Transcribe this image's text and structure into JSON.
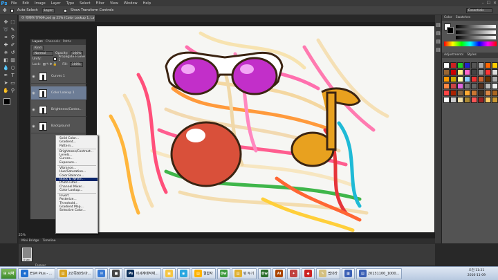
{
  "app": {
    "logo": "Ps"
  },
  "menu": [
    "File",
    "Edit",
    "Image",
    "Layer",
    "Type",
    "Select",
    "Filter",
    "View",
    "Window",
    "Help"
  ],
  "window_controls": [
    "–",
    "☐",
    "✕"
  ],
  "options": {
    "auto_select": "Auto-Select:",
    "layer_value": "Layer",
    "show_transform": "Show Transform Controls",
    "workspace": "Essentials"
  },
  "document": {
    "tab_title": "이 목배하기7909.psd @ 25% (Color Lookup 1, Layer Mask/8)"
  },
  "status": {
    "zoom": "25%"
  },
  "layers": {
    "tabs": [
      "Layers",
      "Channels",
      "Paths"
    ],
    "filter_kind": "Kind",
    "blend_mode": "Normal",
    "opacity_label": "Opacity:",
    "opacity_value": "100%",
    "unify_label": "Unify:",
    "propagate_label": "Propagate Frame 1",
    "lock_label": "Lock:",
    "fill_label": "Fill:",
    "fill_value": "100%",
    "items": [
      {
        "name": "Curves 1"
      },
      {
        "name": "Color Lookup 1"
      },
      {
        "name": "Brightness/Contra..."
      },
      {
        "name": "Background"
      }
    ]
  },
  "context_menu": {
    "groups": [
      [
        "Solid Color...",
        "Gradient...",
        "Pattern..."
      ],
      [
        "Brightness/Contrast...",
        "Levels...",
        "Curves...",
        "Exposure..."
      ],
      [
        "Vibrance...",
        "Hue/Saturation...",
        "Color Balance...",
        "Black & White...",
        "Photo Filter...",
        "Channel Mixer...",
        "Color Lookup..."
      ],
      [
        "Invert",
        "Posterize...",
        "Threshold...",
        "Gradient Map...",
        "Selective Color..."
      ]
    ],
    "highlighted": "Black & White..."
  },
  "right_panel": {
    "color_tabs": [
      "Color",
      "Swatches"
    ],
    "style_tabs": [
      "Adjustments",
      "Styles"
    ]
  },
  "timeline": {
    "tabs": [
      "Mini Bridge",
      "Timeline"
    ],
    "frame_delay": "0 sec.",
    "loop": "Forever"
  },
  "taskbar": {
    "start": "시작",
    "items": [
      {
        "label": "ESM Plus - ...",
        "icon_color": "#1f6fd1",
        "icon": "e"
      },
      {
        "label": "2안쪽정리(아...",
        "icon_color": "#d9a420",
        "icon": "▤"
      },
      {
        "label": "",
        "icon_color": "#3a7bd5",
        "icon": "✉"
      },
      {
        "label": "",
        "icon_color": "#444444",
        "icon": "■"
      },
      {
        "label": "이세계에적재...",
        "icon_color": "#0b2f5a",
        "icon": "Ps"
      },
      {
        "label": "",
        "icon_color": "#f5c542",
        "icon": "▣"
      },
      {
        "label": "",
        "icon_color": "#2aa7e0",
        "icon": "◉"
      },
      {
        "label": "결합자",
        "icon_color": "#ffb300",
        "icon": "▤"
      },
      {
        "label": "",
        "icon_color": "#3c9a3c",
        "icon": "Dw"
      },
      {
        "label": "뭐 두기",
        "icon_color": "#e0b030",
        "icon": "▤"
      },
      {
        "label": "",
        "icon_color": "#2b6e2b",
        "icon": "Dw"
      },
      {
        "label": "",
        "icon_color": "#aa4400",
        "icon": "Ai"
      },
      {
        "label": "",
        "icon_color": "#c04040",
        "icon": "✦"
      },
      {
        "label": "",
        "icon_color": "#cc2222",
        "icon": "◆"
      },
      {
        "label": "팝의라",
        "icon_color": "#d4c080",
        "icon": "✎"
      },
      {
        "label": "",
        "icon_color": "#3a5fb5",
        "icon": "▦"
      },
      {
        "label": "20131100_1000...",
        "icon_color": "#3a5fb5",
        "icon": "▤"
      }
    ],
    "clock_time": "오전 11:21",
    "clock_date": "2016-11-09"
  },
  "style_colors": [
    "#ffffff",
    "#cc2222",
    "#22cc22",
    "#2222cc",
    "#555555",
    "#aaaaaa",
    "#ff6600",
    "#ffcc00",
    "#996633",
    "#cc0000",
    "#ffee88",
    "#ff66cc",
    "#444444",
    "#999999",
    "#ff3333",
    "#dddddd",
    "#ff9900",
    "#ccaa00",
    "#ffffaa",
    "#88ccff",
    "#ee3333",
    "#cc6633",
    "#663300",
    "#aaaaaa",
    "#ff8844",
    "#cc4444",
    "#dd66dd",
    "#777777",
    "#666666",
    "#553322",
    "#bbbbbb",
    "#eeeeee",
    "#ff4444",
    "#aa2200",
    "#886644",
    "#ffaa33",
    "#cc7733",
    "#443322",
    "#dd8844",
    "#aa6622",
    "#ffffff",
    "#cccccc",
    "#eeddaa",
    "#aa8833",
    "#ff5555",
    "#992222",
    "#ffcc66",
    "#cc9933"
  ]
}
